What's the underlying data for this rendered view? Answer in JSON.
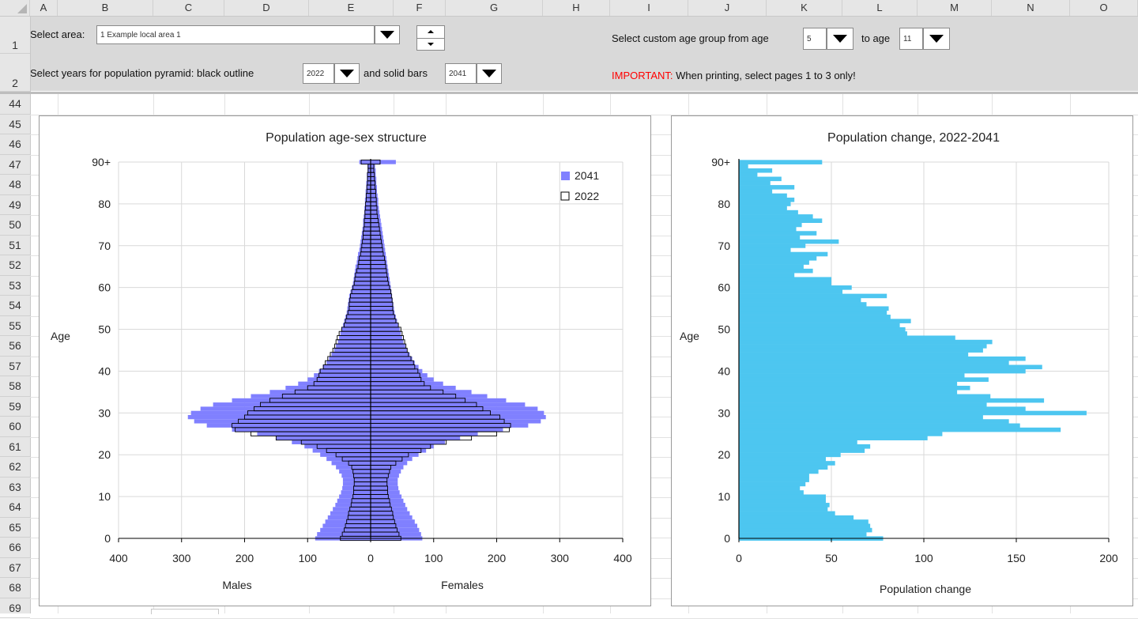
{
  "colors": {
    "pyramid_fill": "#8080ff",
    "pyramid_outline": "#000000",
    "change_fill": "#4dc6f0",
    "important_red": "#ff0000",
    "sheet_header": "#e6e6e6",
    "frozen_panel": "#d9d9d9"
  },
  "spreadsheet": {
    "columns": [
      "A",
      "B",
      "C",
      "D",
      "E",
      "F",
      "G",
      "H",
      "I",
      "J",
      "K",
      "L",
      "M",
      "N",
      "O"
    ],
    "frozen_rows": [
      "1",
      "2"
    ],
    "rows": [
      "44",
      "45",
      "46",
      "47",
      "48",
      "49",
      "50",
      "51",
      "52",
      "53",
      "54",
      "55",
      "56",
      "57",
      "58",
      "59",
      "60",
      "61",
      "62",
      "63",
      "64",
      "65",
      "66",
      "67",
      "68",
      "69"
    ]
  },
  "controls": {
    "area_label": "Select area:",
    "area_value": "1 Example local area 1",
    "years_label": "Select years for population pyramid: black outline",
    "year_outline": "2022",
    "solid_label": "and solid bars",
    "year_solid": "2041",
    "age_from_label": "Select custom age group from age",
    "age_from": "5",
    "age_to_label": "to age",
    "age_to": "11",
    "important_prefix": "IMPORTANT:",
    "important_text": " When printing, select pages 1 to 3 only!"
  },
  "chart_data": [
    {
      "type": "bar",
      "orientation": "horizontal",
      "title": "Population age-sex structure",
      "ylabel": "Age",
      "xlabel_left": "Males",
      "xlabel_right": "Females",
      "xlim": [
        -400,
        400
      ],
      "x_ticks": [
        "400",
        "300",
        "200",
        "100",
        "0",
        "100",
        "200",
        "300",
        "400"
      ],
      "y_ticks": [
        "0",
        "10",
        "20",
        "30",
        "40",
        "50",
        "60",
        "70",
        "80",
        "90+"
      ],
      "grid": true,
      "legend_position": "top-right",
      "legend": [
        "2041",
        "2022"
      ],
      "ages": [
        0,
        1,
        2,
        3,
        4,
        5,
        6,
        7,
        8,
        9,
        10,
        11,
        12,
        13,
        14,
        15,
        16,
        17,
        18,
        19,
        20,
        21,
        22,
        23,
        24,
        25,
        26,
        27,
        28,
        29,
        30,
        31,
        32,
        33,
        34,
        35,
        36,
        37,
        38,
        39,
        40,
        41,
        42,
        43,
        44,
        45,
        46,
        47,
        48,
        49,
        50,
        51,
        52,
        53,
        54,
        55,
        56,
        57,
        58,
        59,
        60,
        61,
        62,
        63,
        64,
        65,
        66,
        67,
        68,
        69,
        70,
        71,
        72,
        73,
        74,
        75,
        76,
        77,
        78,
        79,
        80,
        81,
        82,
        83,
        84,
        85,
        86,
        87,
        88,
        89,
        "90+"
      ],
      "series": [
        {
          "name": "2041",
          "role": "solid bars",
          "male": [
            88,
            85,
            80,
            76,
            72,
            68,
            64,
            60,
            56,
            53,
            50,
            47,
            45,
            44,
            44,
            46,
            50,
            55,
            62,
            70,
            80,
            92,
            105,
            125,
            150,
            180,
            220,
            260,
            280,
            290,
            285,
            270,
            250,
            220,
            190,
            160,
            135,
            115,
            100,
            90,
            82,
            76,
            70,
            66,
            62,
            58,
            55,
            52,
            50,
            48,
            46,
            44,
            42,
            40,
            38,
            37,
            36,
            35,
            34,
            32,
            30,
            28,
            27,
            26,
            25,
            24,
            22,
            21,
            20,
            18,
            17,
            16,
            15,
            14,
            13,
            12,
            12,
            11,
            10,
            10,
            9,
            9,
            8,
            8,
            7,
            7,
            6,
            6,
            5,
            5,
            18
          ],
          "female": [
            82,
            80,
            77,
            74,
            70,
            66,
            62,
            58,
            55,
            52,
            49,
            46,
            44,
            43,
            43,
            45,
            48,
            52,
            58,
            66,
            76,
            88,
            100,
            118,
            142,
            170,
            210,
            250,
            270,
            278,
            275,
            265,
            245,
            215,
            185,
            160,
            135,
            115,
            100,
            90,
            82,
            76,
            70,
            66,
            62,
            58,
            55,
            52,
            50,
            48,
            46,
            44,
            42,
            40,
            38,
            37,
            36,
            35,
            34,
            33,
            32,
            31,
            30,
            29,
            28,
            27,
            26,
            25,
            24,
            23,
            22,
            21,
            20,
            19,
            18,
            17,
            16,
            15,
            14,
            13,
            12,
            12,
            11,
            10,
            10,
            9,
            9,
            8,
            8,
            7,
            40
          ]
        },
        {
          "name": "2022",
          "role": "black outline",
          "male": [
            48,
            45,
            42,
            40,
            38,
            36,
            35,
            33,
            31,
            30,
            28,
            27,
            27,
            26,
            26,
            27,
            28,
            30,
            35,
            45,
            55,
            70,
            85,
            110,
            150,
            190,
            215,
            220,
            210,
            200,
            195,
            185,
            175,
            160,
            140,
            120,
            100,
            90,
            85,
            82,
            80,
            75,
            72,
            68,
            64,
            60,
            57,
            55,
            53,
            50,
            46,
            42,
            40,
            38,
            36,
            34,
            34,
            33,
            32,
            30,
            28,
            26,
            25,
            24,
            22,
            20,
            19,
            18,
            16,
            15,
            14,
            13,
            12,
            12,
            11,
            10,
            10,
            9,
            9,
            8,
            8,
            7,
            7,
            6,
            6,
            5,
            5,
            5,
            4,
            4,
            15
          ],
          "female": [
            48,
            45,
            42,
            40,
            38,
            36,
            35,
            33,
            31,
            30,
            28,
            27,
            27,
            26,
            26,
            28,
            30,
            32,
            40,
            50,
            60,
            80,
            95,
            120,
            160,
            200,
            220,
            222,
            212,
            205,
            190,
            178,
            168,
            150,
            135,
            115,
            95,
            85,
            80,
            78,
            75,
            70,
            68,
            64,
            60,
            58,
            56,
            54,
            52,
            50,
            48,
            44,
            40,
            38,
            36,
            35,
            35,
            34,
            33,
            32,
            30,
            28,
            27,
            26,
            25,
            24,
            23,
            22,
            20,
            19,
            18,
            17,
            16,
            15,
            14,
            13,
            12,
            11,
            10,
            10,
            9,
            9,
            8,
            8,
            7,
            7,
            6,
            6,
            5,
            5,
            15
          ]
        }
      ]
    },
    {
      "type": "bar",
      "orientation": "horizontal",
      "title": "Population change, 2022-2041",
      "ylabel": "Age",
      "xlabel": "Population change",
      "xlim": [
        0,
        200
      ],
      "x_ticks": [
        "0",
        "50",
        "100",
        "150",
        "200"
      ],
      "y_ticks": [
        "0",
        "10",
        "20",
        "30",
        "40",
        "50",
        "60",
        "70",
        "80",
        "90+"
      ],
      "grid": true,
      "ages": [
        0,
        1,
        2,
        3,
        4,
        5,
        6,
        7,
        8,
        9,
        10,
        11,
        12,
        13,
        14,
        15,
        16,
        17,
        18,
        19,
        20,
        21,
        22,
        23,
        24,
        25,
        26,
        27,
        28,
        29,
        30,
        31,
        32,
        33,
        34,
        35,
        36,
        37,
        38,
        39,
        40,
        41,
        42,
        43,
        44,
        45,
        46,
        47,
        48,
        49,
        50,
        51,
        52,
        53,
        54,
        55,
        56,
        57,
        58,
        59,
        60,
        61,
        62,
        63,
        64,
        65,
        66,
        67,
        68,
        69,
        70,
        71,
        72,
        73,
        74,
        75,
        76,
        77,
        78,
        79,
        80,
        81,
        82,
        83,
        84,
        85,
        86,
        87,
        88,
        89,
        "90+"
      ],
      "values": [
        78,
        69,
        72,
        71,
        70,
        62,
        52,
        48,
        49,
        47,
        47,
        35,
        33,
        36,
        38,
        38,
        43,
        48,
        52,
        47,
        55,
        68,
        71,
        64,
        102,
        110,
        174,
        152,
        146,
        132,
        188,
        155,
        134,
        165,
        136,
        118,
        125,
        118,
        135,
        122,
        155,
        164,
        146,
        155,
        124,
        132,
        134,
        137,
        117,
        91,
        90,
        87,
        93,
        82,
        80,
        81,
        69,
        66,
        80,
        56,
        61,
        50,
        50,
        30,
        40,
        35,
        38,
        42,
        48,
        28,
        36,
        54,
        33,
        42,
        31,
        34,
        45,
        40,
        32,
        26,
        28,
        30,
        26,
        18,
        30,
        17,
        23,
        10,
        18,
        5,
        45
      ]
    }
  ]
}
